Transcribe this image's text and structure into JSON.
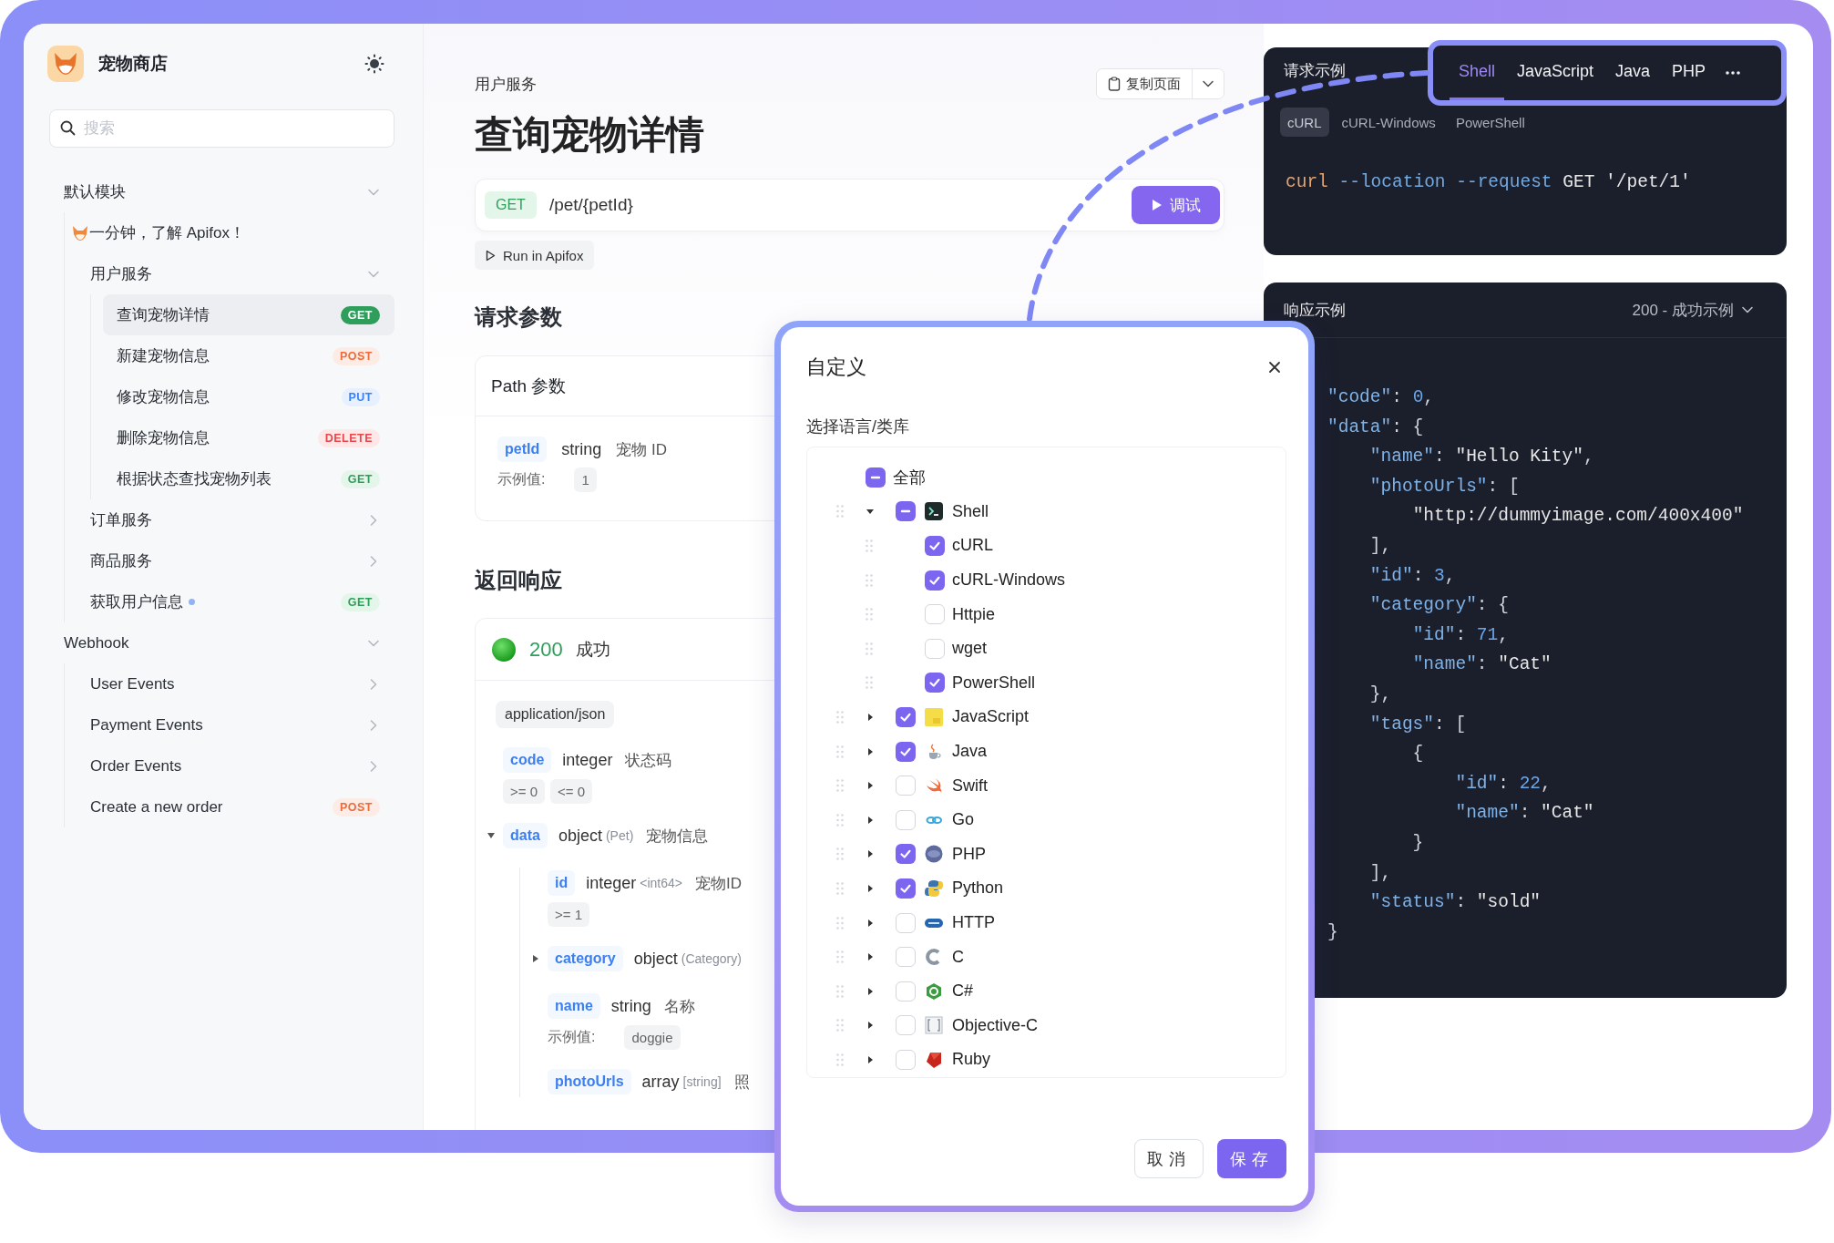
{
  "sidebar": {
    "title": "宠物商店",
    "search": {
      "placeholder": "搜索"
    },
    "tree": [
      {
        "kind": "folder",
        "label": "默认模块",
        "expanded": true,
        "children": [
          {
            "kind": "doc",
            "label": "一分钟，了解 Apifox！",
            "selected": false
          },
          {
            "kind": "folder",
            "label": "用户服务",
            "expanded": true,
            "children": [
              {
                "kind": "endpoint",
                "label": "查询宠物详情",
                "method": "GET",
                "selected": true
              },
              {
                "kind": "endpoint",
                "label": "新建宠物信息",
                "method": "POST",
                "selected": false
              },
              {
                "kind": "endpoint",
                "label": "修改宠物信息",
                "method": "PUT",
                "selected": false
              },
              {
                "kind": "endpoint",
                "label": "删除宠物信息",
                "method": "DELETE",
                "selected": false
              },
              {
                "kind": "endpoint",
                "label": "根据状态查找宠物列表",
                "method": "GET",
                "selected": false
              }
            ]
          },
          {
            "kind": "folder",
            "label": "订单服务",
            "expanded": false
          },
          {
            "kind": "folder",
            "label": "商品服务",
            "expanded": false
          },
          {
            "kind": "endpoint",
            "label": "获取用户信息",
            "method": "GET",
            "selected": false,
            "dot": true
          }
        ]
      },
      {
        "kind": "folder",
        "label": "Webhook",
        "expanded": true,
        "children": [
          {
            "kind": "folder",
            "label": "User Events",
            "expanded": false
          },
          {
            "kind": "folder",
            "label": "Payment Events",
            "expanded": false
          },
          {
            "kind": "folder",
            "label": "Order Events",
            "expanded": false
          },
          {
            "kind": "endpoint",
            "label": "Create a new order",
            "method": "POST",
            "selected": false
          }
        ]
      }
    ]
  },
  "doc": {
    "breadcrumb": "用户服务",
    "title": "查询宠物详情",
    "copy_button": "复制页面",
    "request": {
      "method": "GET",
      "path": "/pet/{petId}",
      "debug_button": "调试"
    },
    "run_button": "Run in Apifox",
    "params_heading": "请求参数",
    "path_params": {
      "title": "Path 参数",
      "params": [
        {
          "name": "petId",
          "type": "string",
          "description": "宠物 ID",
          "example_label": "示例值:",
          "example": "1"
        }
      ]
    },
    "response_heading": "返回响应",
    "response": {
      "status": "200",
      "status_text": "成功",
      "content_type": "application/json",
      "fields": [
        {
          "name": "code",
          "type": "integer",
          "description": "状态码",
          "constraints": [
            ">= 0",
            "<= 0"
          ]
        },
        {
          "name": "data",
          "type": "object",
          "format": "(Pet)",
          "description": "宠物信息",
          "expanded": true,
          "children": [
            {
              "name": "id",
              "type": "integer",
              "format": "<int64>",
              "description": "宠物ID",
              "constraints": [
                ">= 1"
              ]
            },
            {
              "name": "category",
              "type": "object",
              "format": "(Category)",
              "expanded": false
            },
            {
              "name": "name",
              "type": "string",
              "description": "名称",
              "example_label": "示例值:",
              "example": "doggie"
            },
            {
              "name": "photoUrls",
              "type": "array",
              "format": "[string]",
              "description": "照"
            }
          ]
        }
      ]
    }
  },
  "request_example": {
    "title": "请求示例",
    "tabs": [
      {
        "label": "Shell",
        "selected": true
      },
      {
        "label": "JavaScript",
        "selected": false
      },
      {
        "label": "Java",
        "selected": false
      },
      {
        "label": "PHP",
        "selected": false
      }
    ],
    "subtabs": [
      {
        "label": "cURL",
        "selected": true
      },
      {
        "label": "cURL-Windows",
        "selected": false
      },
      {
        "label": "PowerShell",
        "selected": false
      }
    ],
    "code": [
      {
        "text": "curl",
        "kind": "command"
      },
      {
        "text": " --location --request",
        "kind": "option"
      },
      {
        "text": " GET '/pet/1'",
        "kind": "argument"
      }
    ]
  },
  "response_example": {
    "title": "响应示例",
    "example_select": "200 - 成功示例",
    "code_lines": [
      "\"code\": 0,",
      "\"data\": {",
      "    \"name\": \"Hello Kity\",",
      "    \"photoUrls\": [",
      "        \"http://dummyimage.com/400x400\"",
      "    ],",
      "    \"id\": 3,",
      "    \"category\": {",
      "        \"id\": 71,",
      "        \"name\": \"Cat\"",
      "    },",
      "    \"tags\": [",
      "        {",
      "            \"id\": 22,",
      "            \"name\": \"Cat\"",
      "        }",
      "    ],",
      "    \"status\": \"sold\"",
      "}"
    ]
  },
  "dialog": {
    "title": "自定义",
    "subtitle": "选择语言/类库",
    "tree": {
      "label": "全部",
      "indeterminate": true,
      "children": [
        {
          "label": "Shell",
          "indeterminate": true,
          "expanded": true,
          "children": [
            {
              "label": "cURL",
              "checked": true
            },
            {
              "label": "cURL-Windows",
              "checked": true
            },
            {
              "label": "Httpie",
              "checked": false
            },
            {
              "label": "wget",
              "checked": false
            },
            {
              "label": "PowerShell",
              "checked": true
            }
          ]
        },
        {
          "label": "JavaScript",
          "checked": true,
          "expanded": false
        },
        {
          "label": "Java",
          "checked": true,
          "expanded": false
        },
        {
          "label": "Swift",
          "checked": false,
          "expanded": false
        },
        {
          "label": "Go",
          "checked": false,
          "expanded": false
        },
        {
          "label": "PHP",
          "checked": true,
          "expanded": false
        },
        {
          "label": "Python",
          "checked": true,
          "expanded": false
        },
        {
          "label": "HTTP",
          "checked": false,
          "expanded": false
        },
        {
          "label": "C",
          "checked": false,
          "expanded": false
        },
        {
          "label": "C#",
          "checked": false,
          "expanded": false
        },
        {
          "label": "Objective-C",
          "checked": false,
          "expanded": false
        },
        {
          "label": "Ruby",
          "checked": false,
          "expanded": false
        }
      ]
    },
    "cancel_button": "取消",
    "save_button": "保存"
  }
}
